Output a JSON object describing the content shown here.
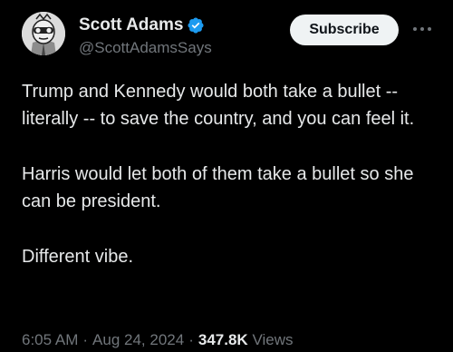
{
  "author": {
    "display_name": "Scott Adams",
    "handle": "@ScottAdamsSays",
    "verified": true,
    "verified_color": "#1d9bf0"
  },
  "actions": {
    "subscribe_label": "Subscribe",
    "more_icon": "more-horizontal-icon"
  },
  "tweet": {
    "paragraphs": [
      "Trump and Kennedy would both take a bullet -- literally -- to save the country, and you can feel it.",
      "Harris would let both of them take a bullet so she can be president.",
      "Different vibe."
    ]
  },
  "meta": {
    "time": "6:05 AM",
    "separator": "·",
    "date": "Aug 24, 2024",
    "views_count": "347.8K",
    "views_label": "Views"
  },
  "colors": {
    "background": "#000000",
    "text_primary": "#e7e9ea",
    "text_secondary": "#71767b",
    "button_bg": "#eff3f4",
    "button_text": "#0f1419"
  }
}
